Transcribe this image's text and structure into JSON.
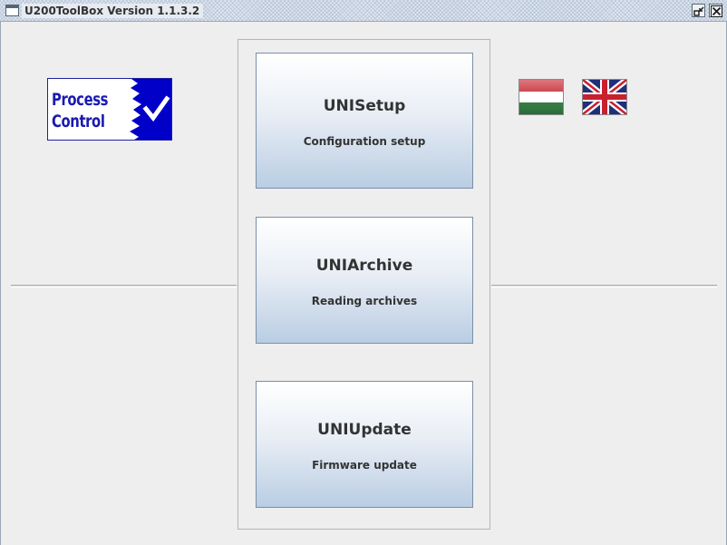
{
  "window": {
    "title": "U200ToolBox Version 1.1.3.2",
    "icons": [
      "app-window-icon",
      "restore-icon",
      "close-icon"
    ]
  },
  "logo": {
    "line1": "Process",
    "line2": "Control",
    "icon": "checkmark-icon",
    "colors": {
      "text": "#1a1ab0",
      "box": "#0000c8"
    }
  },
  "languages": [
    {
      "code": "hu",
      "icon": "hungarian-flag-icon"
    },
    {
      "code": "en",
      "icon": "uk-flag-icon"
    }
  ],
  "modules": [
    {
      "title": "UNISetup",
      "subtitle": "Configuration setup"
    },
    {
      "title": "UNIArchive",
      "subtitle": "Reading archives"
    },
    {
      "title": "UNIUpdate",
      "subtitle": "Firmware update"
    }
  ],
  "colors": {
    "background": "#eeeeee",
    "button_gradient_top": "#ffffff",
    "button_gradient_bottom": "#b9cde3",
    "button_border": "#7a8fa8"
  }
}
